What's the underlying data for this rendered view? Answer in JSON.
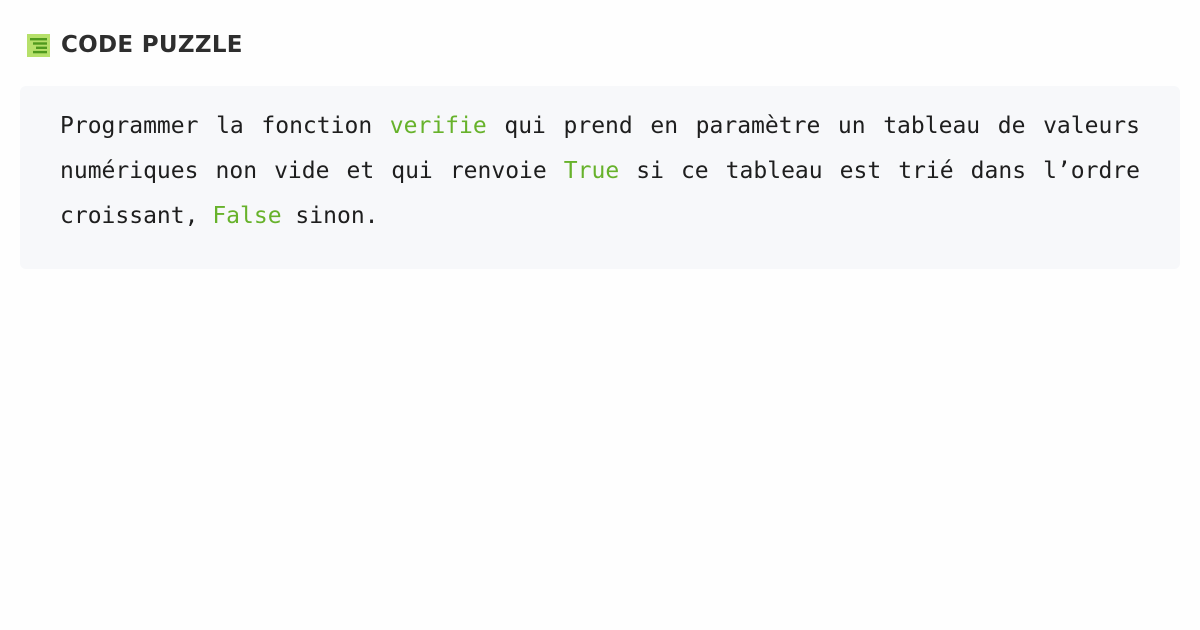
{
  "header": {
    "logo_icon": "code-puzzle-logo-icon",
    "title": "CODE PUZZLE"
  },
  "colors": {
    "accent": "#67b22b",
    "logo_bg": "#b6e06a",
    "logo_lines": "#4f9a1e",
    "card_bg": "#f7f8fa",
    "text": "#1e1e1e"
  },
  "problem": {
    "segments": [
      "Programmer la fonction ",
      "verifie",
      " qui prend en paramètre un tableau de valeurs numériques non vide et qui renvoie ",
      "True",
      " si ce tableau est trié dans l’ordre croissant, ",
      "False",
      " sinon."
    ]
  }
}
